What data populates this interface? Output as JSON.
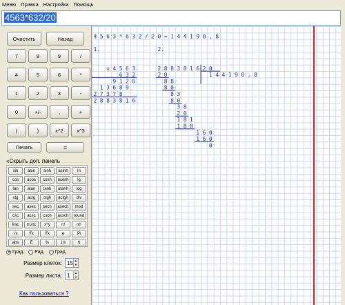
{
  "menu": [
    "Меню",
    "Правка",
    "Настройки",
    "Помощь"
  ],
  "expression": "4563*632/20",
  "buttons": {
    "clear": "Очистить",
    "back": "Назад",
    "keypad": [
      "7",
      "8",
      "9",
      "/",
      "4",
      "5",
      "6",
      "*",
      "1",
      "2",
      "3",
      "-",
      "0",
      "+/-",
      ",",
      "+",
      "(",
      ")",
      "x^2",
      "x^3"
    ],
    "print": "Печать",
    "equals": "="
  },
  "panel": {
    "toggle_arrows": "«",
    "toggle_label": "Скрыть  доп. панель"
  },
  "functions": [
    "sin",
    "asin",
    "sinh",
    "asinh",
    "ln",
    "cos",
    "acos",
    "cosh",
    "acosh",
    "lg",
    "tan",
    "atan",
    "tanh",
    "atanh",
    "log",
    "ctg",
    "actg",
    "ctgh",
    "actgh",
    "div",
    "sec",
    "asec",
    "sech",
    "asech",
    "mod",
    "csc",
    "acsc",
    "csch",
    "acsch",
    "round",
    "frac",
    "trunc",
    "x^y",
    "n!",
    "n!!",
    "√x",
    "∛x",
    "∜x",
    "e",
    "Pi",
    "abs",
    "E",
    "%",
    "1/x",
    "↯"
  ],
  "angle": {
    "options": [
      "Град.",
      "Рад.",
      "Град"
    ],
    "selected": 0
  },
  "cell_size": {
    "label": "Размер клеток:",
    "value": "15"
  },
  "sheet_size": {
    "label": "Размер листа:",
    "value": "1"
  },
  "help": "Как пользоваться ?",
  "paper": {
    "header": [
      "4",
      "5",
      "6",
      "3",
      "*",
      "6",
      "3",
      "2",
      "/",
      "2",
      "0",
      "=",
      "1",
      "4",
      "4",
      "1",
      "9",
      "0",
      ",",
      "8"
    ],
    "step1": "1.",
    "step2": "2.",
    "mult": {
      "a": [
        "4",
        "5",
        "6",
        "3"
      ],
      "b": [
        "6",
        "3",
        "2"
      ],
      "x": "x",
      "partials": [
        [
          "9",
          "1",
          "2",
          "6"
        ],
        [
          "1",
          "3",
          "6",
          "8",
          "9"
        ],
        [
          "2",
          "7",
          "3",
          "7",
          "8"
        ]
      ],
      "result": [
        "2",
        "8",
        "8",
        "3",
        "8",
        "1",
        "6"
      ]
    },
    "div": {
      "dividend": [
        "2",
        "8",
        "8",
        "3",
        "8",
        "1",
        "6"
      ],
      "divisor": [
        "2",
        "0"
      ],
      "quotient": [
        "1",
        "4",
        "4",
        "1",
        "9",
        "0",
        ",",
        "8"
      ],
      "steps": [
        [
          "2",
          "0"
        ],
        [
          "8",
          "8"
        ],
        [
          "8",
          "0"
        ],
        [
          "8",
          "3"
        ],
        [
          "8",
          "0"
        ],
        [
          "3",
          "8"
        ],
        [
          "2",
          "0"
        ],
        [
          "1",
          "8",
          "1"
        ],
        [
          "1",
          "8",
          "0"
        ],
        [
          "1",
          "6",
          "0"
        ],
        [
          "1",
          "6",
          "0"
        ],
        [
          "0"
        ]
      ]
    }
  }
}
